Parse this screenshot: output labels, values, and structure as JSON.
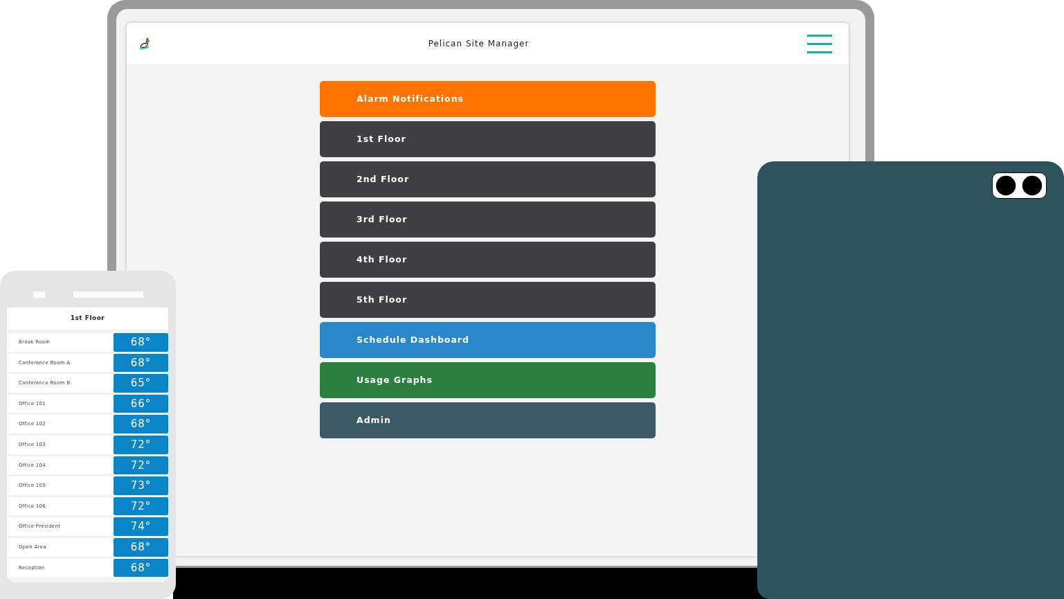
{
  "laptop": {
    "title": "Pelican Site Manager",
    "menu": [
      {
        "label": "Alarm Notifications",
        "color": "#ff7300"
      },
      {
        "label": "1st Floor",
        "color": "#404042"
      },
      {
        "label": "2nd Floor",
        "color": "#404042"
      },
      {
        "label": "3rd Floor",
        "color": "#404042"
      },
      {
        "label": "4th Floor",
        "color": "#404042"
      },
      {
        "label": "5th Floor",
        "color": "#404042"
      },
      {
        "label": "Schedule Dashboard",
        "color": "#2a88c9"
      },
      {
        "label": "Usage Graphs",
        "color": "#2c7f3f"
      },
      {
        "label": "Admin",
        "color": "#395a64"
      }
    ]
  },
  "phone": {
    "title": "1st Floor",
    "rooms": [
      {
        "name": "Break Room",
        "temperature": "68°"
      },
      {
        "name": "Conference Room A",
        "temperature": "68°"
      },
      {
        "name": "Conference Room B",
        "temperature": "65°"
      },
      {
        "name": "Office 101",
        "temperature": "66°"
      },
      {
        "name": "Office 102",
        "temperature": "68°"
      },
      {
        "name": "Office 103",
        "temperature": "72°"
      },
      {
        "name": "Office 104",
        "temperature": "72°"
      },
      {
        "name": "Office 105",
        "temperature": "73°"
      },
      {
        "name": "Office 106",
        "temperature": "72°"
      },
      {
        "name": "Office President",
        "temperature": "74°"
      },
      {
        "name": "Open Area",
        "temperature": "68°"
      },
      {
        "name": "Reception",
        "temperature": "68°"
      }
    ]
  }
}
